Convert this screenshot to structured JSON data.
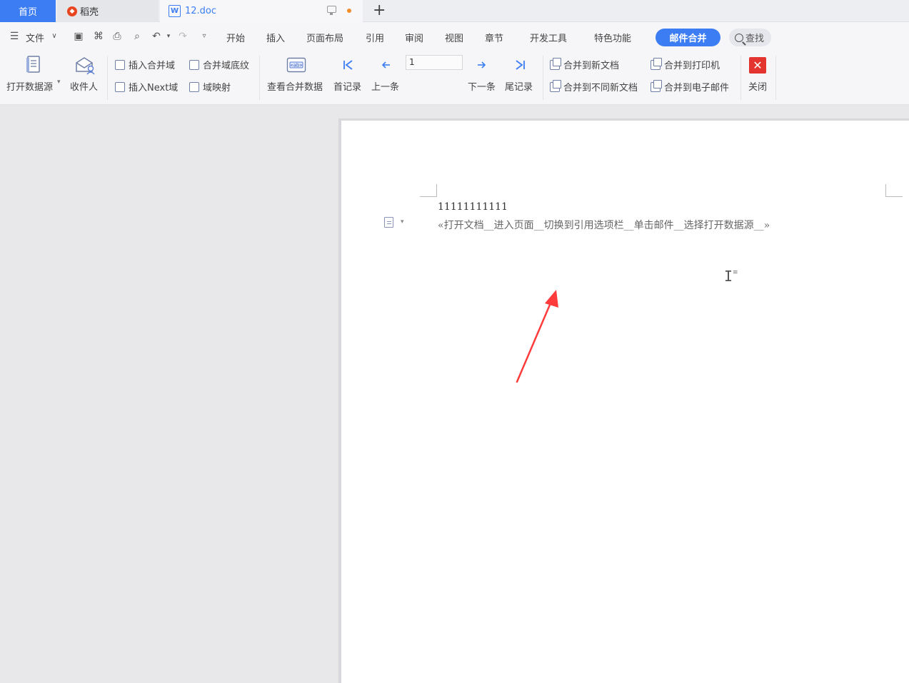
{
  "tabs": {
    "home": "首页",
    "daoke": "稻壳",
    "doc": "12.doc",
    "new_tab": "+"
  },
  "menu": {
    "file": "文件",
    "items": [
      "开始",
      "插入",
      "页面布局",
      "引用",
      "审阅",
      "视图",
      "章节",
      "开发工具",
      "特色功能"
    ],
    "active": "邮件合并",
    "search": "查找"
  },
  "ribbon": {
    "open_datasource": "打开数据源",
    "recipients": "收件人",
    "insert_merge_field": "插入合并域",
    "merge_field_shading": "合并域底纹",
    "insert_next_field": "插入Next域",
    "field_mapping": "域映射",
    "view_merged_data": "查看合并数据",
    "first_record": "首记录",
    "prev_record": "上一条",
    "record_number": "1",
    "next_record": "下一条",
    "last_record": "尾记录",
    "merge_to_new_doc": "合并到新文档",
    "merge_to_different_docs": "合并到不同新文档",
    "merge_to_printer": "合并到打印机",
    "merge_to_email": "合并到电子邮件",
    "close": "关闭"
  },
  "document": {
    "line1": "11111111111",
    "line2": "«打开文档__进入页面__切换到引用选项栏__单击邮件__选择打开数据源__»"
  },
  "colors": {
    "accent": "#3c7df3",
    "close": "#e3342f",
    "annotation_arrow": "#ff3b3b"
  }
}
